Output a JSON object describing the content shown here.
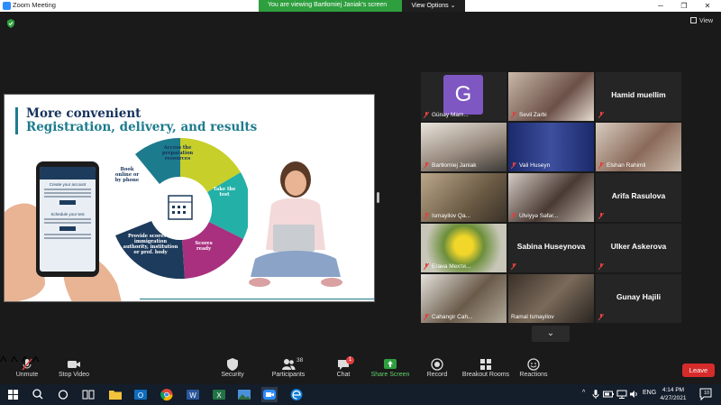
{
  "window": {
    "title": "Zoom Meeting",
    "minimize": "─",
    "maximize": "❐",
    "close": "✕"
  },
  "banner": {
    "viewing": "You are viewing Bartłomiej Janiak's screen",
    "view_options": "View Options ⌄"
  },
  "view_button": "View",
  "slide": {
    "title_line1": "More convenient",
    "title_line2": "Registration, delivery, and results",
    "phone": {
      "heading": "Create your account",
      "schedule": "Schedule your test"
    },
    "wheel": {
      "access": "Access the preparation resources",
      "book": "Book online or by phone",
      "take": "Take the test",
      "scores": "Scores ready",
      "provide": "Provide scores to immigration authority, institution or prof. body"
    }
  },
  "participants": [
    {
      "name": "Günay Mam...",
      "initial": "G",
      "type": "avatar"
    },
    {
      "name": "Sevil Zarbi",
      "type": "video"
    },
    {
      "name": "Hamid muellim",
      "type": "name"
    },
    {
      "name": "Bartłomiej Janiak",
      "type": "video",
      "active": true
    },
    {
      "name": "Vali Huseyn",
      "type": "video"
    },
    {
      "name": "Elshan Rahimli",
      "type": "video"
    },
    {
      "name": "Ismayilov Qa...",
      "type": "video"
    },
    {
      "name": "Ülviyyə Səfər...",
      "type": "video"
    },
    {
      "name": "Arifa Rasulova",
      "type": "name"
    },
    {
      "name": "Егана Мехти...",
      "type": "video"
    },
    {
      "name": "Sabina Huseynova",
      "type": "name"
    },
    {
      "name": "Ulker Askerova",
      "type": "name"
    },
    {
      "name": "Cahangir Cah...",
      "type": "video"
    },
    {
      "name": "Ramal Ismayilov",
      "type": "video"
    },
    {
      "name": "Gunay Hajili",
      "type": "name"
    }
  ],
  "toolbar": {
    "unmute": "Unmute",
    "stop_video": "Stop Video",
    "security": "Security",
    "participants": "Participants",
    "participants_count": "38",
    "chat": "Chat",
    "chat_badge": "1",
    "share_screen": "Share Screen",
    "record": "Record",
    "breakout": "Breakout Rooms",
    "reactions": "Reactions",
    "leave": "Leave"
  },
  "taskbar": {
    "lang": "ENG",
    "time": "4:14 PM",
    "date": "4/27/2021",
    "notif_count": "10"
  },
  "colors": {
    "share_green": "#2e9f3e",
    "leave_red": "#d62b2b",
    "active_speaker": "#d7e35d",
    "slide_navy": "#16325c",
    "slide_teal": "#1d7b8e"
  }
}
